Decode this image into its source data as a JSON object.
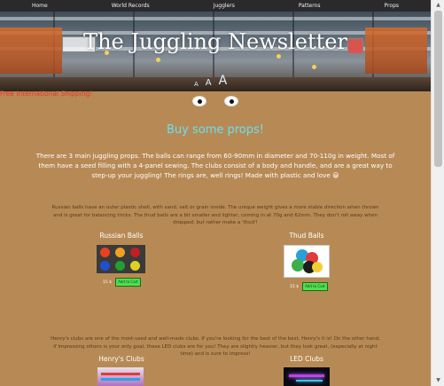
{
  "nav": [
    "Home",
    "World Records",
    "Jugglers",
    "Patterns",
    "Props"
  ],
  "site_title": "The Juggling Newsletter",
  "font_size_controls": [
    "A",
    "A",
    "A"
  ],
  "promo": "Free International Shipping!",
  "heading": "Buy some props!",
  "intro": "There are 3 main juggling props. The balls can range from 60-90mm in diameter and 70-110g in weight. Most of them have a seed filling with a 4-panel sewing. The clubs consist of a body and handle, and are a great way to step-up your juggling! The rings are, well rings! Made with plastic and love 😀",
  "balls_desc": "Russian balls have an outer plastic shell, with sand, salt or grain inside. The unique weight gives a more stable direction when thrown and is great for balancing tricks. The thud balls are a bit smaller and lighter, coming in at 70g and 62mm. They don't roll away when dropped, but rather make a 'thud'!",
  "clubs_desc": "Henry's clubs are one of the most-used and well-made clubs. If you're looking for the best of the best, Henry's it is! On the other hand, if impressing others is your only goal, these LED clubs are for you! They are slightly heavier, but they look great, (especially at night time) and is sure to impress!",
  "products": [
    {
      "name": "Russian Balls",
      "price": "15 $",
      "button": "Add to Cart"
    },
    {
      "name": "Thud Balls",
      "price": "15 $",
      "button": "Add to Cart"
    },
    {
      "name": "Henry's Clubs"
    },
    {
      "name": "LED Clubs"
    }
  ],
  "colors": {
    "background": "#b78a55",
    "heading": "#67e0f2",
    "promo": "#e8342a",
    "cart_button": "#4fe04f",
    "navbar": "#2a2a2a"
  }
}
